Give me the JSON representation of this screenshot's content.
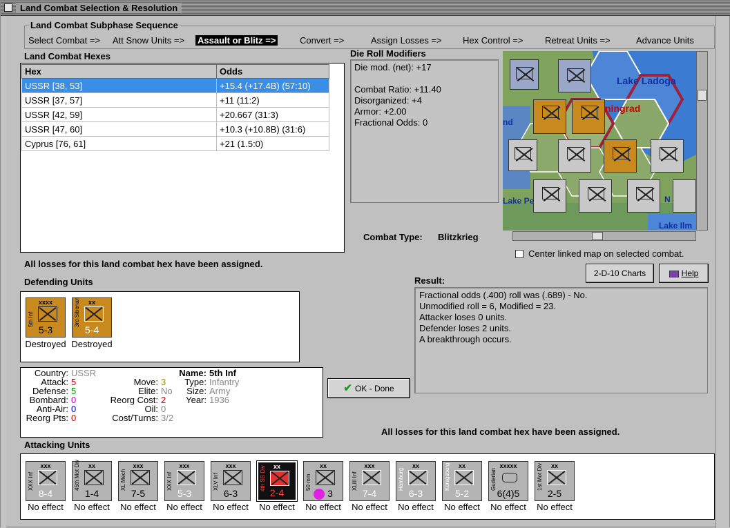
{
  "window": {
    "title": "Land Combat Selection & Resolution"
  },
  "subphase": {
    "heading": "Land Combat Subphase Sequence",
    "steps": [
      "Select Combat =>",
      "Att Snow Units =>",
      "Assault or Blitz =>",
      "Convert =>",
      "Assign Losses =>",
      "Hex Control =>",
      "Retreat Units =>",
      "Advance Units"
    ],
    "active_index": 2
  },
  "hexes": {
    "heading": "Land Combat Hexes",
    "columns": [
      "Hex",
      "Odds"
    ],
    "rows": [
      [
        "USSR [38, 53]",
        "+15.4 (+17.4B) (57:10)"
      ],
      [
        "USSR [37, 57]",
        "+11 (11:2)"
      ],
      [
        "USSR [42, 59]",
        "+20.667 (31:3)"
      ],
      [
        "USSR [47, 60]",
        "+10.3 (+10.8B) (31:6)"
      ],
      [
        "Cyprus [76, 61]",
        "+21 (1.5:0)"
      ]
    ],
    "selected_index": 0
  },
  "drm": {
    "heading": "Die Roll Modifiers",
    "lines": [
      "Die mod. (net): +17",
      "",
      "Combat Ratio: +11.40",
      "Disorganized: +4",
      "Armor: +2.00",
      "Fractional Odds: 0"
    ]
  },
  "combat_type": {
    "label": "Combat Type:",
    "value": "Blitzkrieg"
  },
  "map": {
    "labels": [
      "Lake Ladoga",
      "ningrad",
      "nd",
      "Lake Peip",
      "Lake Ilm",
      "N"
    ],
    "center_checkbox": "Center linked map on selected combat.",
    "center_checked": false
  },
  "losses_msg_top": "All losses for this land combat hex have been assigned.",
  "losses_msg_bottom": "All losses for this land combat hex have been assigned.",
  "defending": {
    "heading": "Defending Units",
    "units": [
      {
        "size": "xxxx",
        "name": "5th Inf",
        "strength": "5-3",
        "status": "Destroyed",
        "color": "#c88a1e"
      },
      {
        "size": "xx",
        "name": "3rd Siberian",
        "strength": "5-4",
        "status": "Destroyed",
        "color": "#c88a1e"
      }
    ]
  },
  "details": {
    "left": [
      {
        "label": "Country:",
        "value": "USSR",
        "color": "#888888"
      },
      {
        "label": "Attack:",
        "value": "5",
        "color": "#cc0000"
      },
      {
        "label": "Defense:",
        "value": "5",
        "color": "#009900"
      },
      {
        "label": "Bombard:",
        "value": "0",
        "color": "#cc00cc"
      },
      {
        "label": "Anti-Air:",
        "value": "0",
        "color": "#0000cc"
      },
      {
        "label": "Reorg Pts:",
        "value": "0",
        "color": "#cc0000"
      }
    ],
    "mid": [
      {
        "label": "Move:",
        "value": "3",
        "color": "#999900"
      },
      {
        "label": "Elite:",
        "value": "No",
        "color": "#888888"
      },
      {
        "label": "Reorg Cost:",
        "value": "2",
        "color": "#cc0000"
      },
      {
        "label": "Oil:",
        "value": "0",
        "color": "#888888"
      },
      {
        "label": "Cost/Turns:",
        "value": "3/2",
        "color": "#888888"
      }
    ],
    "right": [
      {
        "label": "Name:",
        "value": "5th Inf",
        "color": "#000000"
      },
      {
        "label": "Type:",
        "value": "Infantry",
        "color": "#888888"
      },
      {
        "label": "Size:",
        "value": "Army",
        "color": "#888888"
      },
      {
        "label": "Year:",
        "value": "1936",
        "color": "#888888"
      }
    ]
  },
  "buttons": {
    "charts": "2-D-10 Charts",
    "help": "Help",
    "ok": "OK - Done"
  },
  "result": {
    "heading": "Result:",
    "lines": [
      "Fractional odds (.400) roll was (.689)  -  No.",
      "Unmodified roll = 6, Modified = 23.",
      "Attacker loses 0 units.",
      "Defender loses 2 units.",
      "A breakthrough occurs."
    ]
  },
  "attacking": {
    "heading": "Attacking Units",
    "units": [
      {
        "size": "xxx",
        "name": "XXX Inf",
        "strength": "8-4",
        "status": "No effect"
      },
      {
        "size": "xx",
        "name": "45th Mot Div",
        "strength": "1-4",
        "status": "No effect"
      },
      {
        "size": "xxx",
        "name": "XL Mech",
        "strength": "7-5",
        "status": "No effect"
      },
      {
        "size": "xxx",
        "name": "XXX Inf",
        "strength": "5-3",
        "status": "No effect"
      },
      {
        "size": "xxx",
        "name": "XLV Inf",
        "strength": "6-3",
        "status": "No effect"
      },
      {
        "size": "xx",
        "name": "4th SS Div",
        "strength": "2-4",
        "status": "No effect"
      },
      {
        "size": "xx",
        "name": "50 mm",
        "strength": "3",
        "status": "No effect"
      },
      {
        "size": "xxx",
        "name": "XLIII Inf",
        "strength": "7-4",
        "status": "No effect"
      },
      {
        "size": "xx",
        "name": "Hamburg",
        "strength": "6-3",
        "status": "No effect"
      },
      {
        "size": "xx",
        "name": "Königsberg",
        "strength": "5-2",
        "status": "No effect"
      },
      {
        "size": "xxxxx",
        "name": "Guderian",
        "strength": "6(4)5",
        "status": "No effect"
      },
      {
        "size": "xx",
        "name": "1st Mot Div",
        "strength": "2-5",
        "status": "No effect"
      }
    ]
  }
}
